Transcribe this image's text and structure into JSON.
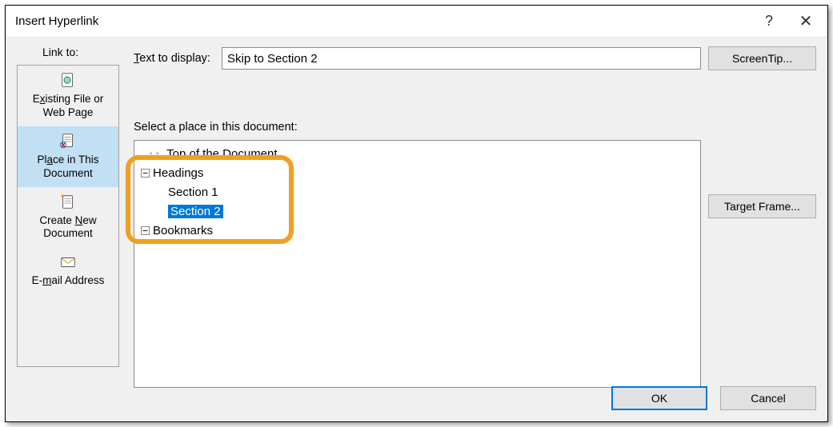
{
  "dialog": {
    "title": "Insert Hyperlink",
    "help": "?",
    "close": "✕"
  },
  "linkto_label": "Link to:",
  "sidebar": {
    "items": [
      {
        "line1_pre": "E",
        "line1_u": "x",
        "line1_post": "isting File or",
        "line2": "Web Page"
      },
      {
        "line1_pre": "Pl",
        "line1_u": "a",
        "line1_post": "ce in This",
        "line2": "Document"
      },
      {
        "line1_pre": "Create ",
        "line1_u": "N",
        "line1_post": "ew",
        "line2": "Document"
      },
      {
        "line1_pre": "E-",
        "line1_u": "m",
        "line1_post": "ail Address",
        "line2": ""
      }
    ]
  },
  "text_display": {
    "label_pre": "",
    "label_u": "T",
    "label_post": "ext to display:",
    "value": "Skip to Section 2"
  },
  "screentip_label": "ScreenTip...",
  "targetframe_label": "Target Frame...",
  "select_place_label": "Select a place in this document:",
  "tree": {
    "top": "Top of the Document",
    "headings": "Headings",
    "section1": "Section 1",
    "section2": "Section 2",
    "bookmarks": "Bookmarks"
  },
  "buttons": {
    "ok": "OK",
    "cancel": "Cancel"
  }
}
